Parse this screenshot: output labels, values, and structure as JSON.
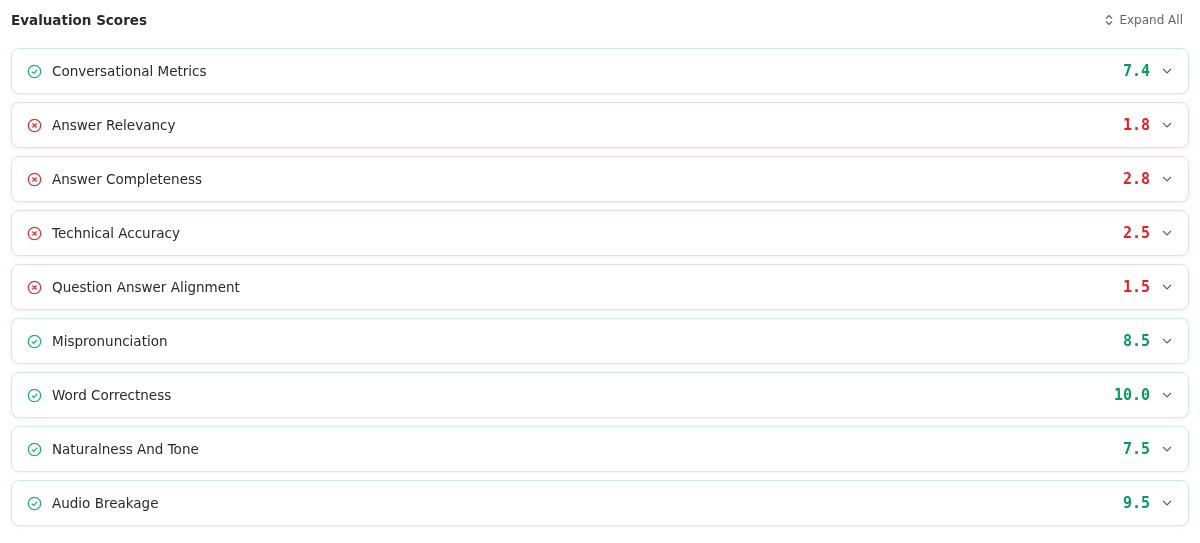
{
  "title": "Evaluation Scores",
  "expand_all": {
    "label": "Expand All"
  },
  "scores": [
    {
      "name": "Conversational Metrics",
      "score": "7.4",
      "kind": "pass"
    },
    {
      "name": "Answer Relevancy",
      "score": "1.8",
      "kind": "fail"
    },
    {
      "name": "Answer Completeness",
      "score": "2.8",
      "kind": "fail"
    },
    {
      "name": "Technical Accuracy",
      "score": "2.5",
      "kind": "fail"
    },
    {
      "name": "Question Answer Alignment",
      "score": "1.5",
      "kind": "fail"
    },
    {
      "name": "Mispronunciation",
      "score": "8.5",
      "kind": "pass"
    },
    {
      "name": "Word Correctness",
      "score": "10.0",
      "kind": "pass"
    },
    {
      "name": "Naturalness And Tone",
      "score": "7.5",
      "kind": "pass"
    },
    {
      "name": "Audio Breakage",
      "score": "9.5",
      "kind": "pass"
    }
  ]
}
